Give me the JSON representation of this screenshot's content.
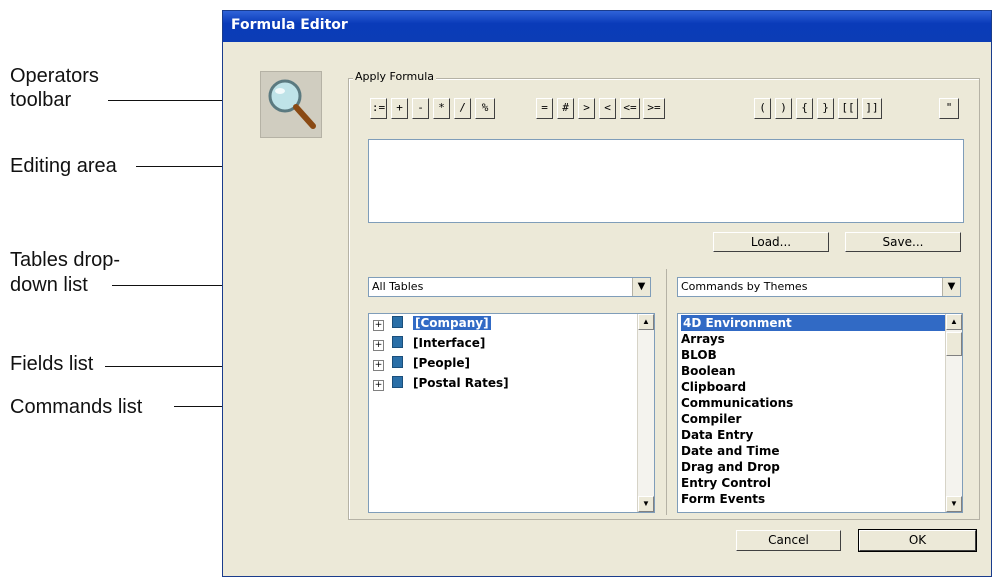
{
  "callouts": {
    "operators": [
      "Operators",
      "toolbar"
    ],
    "editing": "Editing area",
    "tables": [
      "Tables drop-",
      "down list"
    ],
    "fields": "Fields list",
    "commands": "Commands list"
  },
  "window": {
    "title": "Formula Editor"
  },
  "group_label": "Apply Formula",
  "operators": [
    ":=",
    "+",
    "-",
    "*",
    "/",
    "%",
    "=",
    "#",
    ">",
    "<",
    "<=",
    ">=",
    "(",
    ")",
    "{",
    "}",
    "[[",
    "]]",
    "\""
  ],
  "buttons": {
    "load": "Load...",
    "save": "Save...",
    "cancel": "Cancel",
    "ok": "OK"
  },
  "tables_select": "All Tables",
  "commands_select": "Commands by Themes",
  "tables": [
    "[Company]",
    "[Interface]",
    "[People]",
    "[Postal Rates]"
  ],
  "commands": [
    "4D Environment",
    "Arrays",
    "BLOB",
    "Boolean",
    "Clipboard",
    "Communications",
    "Compiler",
    "Data Entry",
    "Date and Time",
    "Drag and Drop",
    "Entry Control",
    "Form Events"
  ]
}
